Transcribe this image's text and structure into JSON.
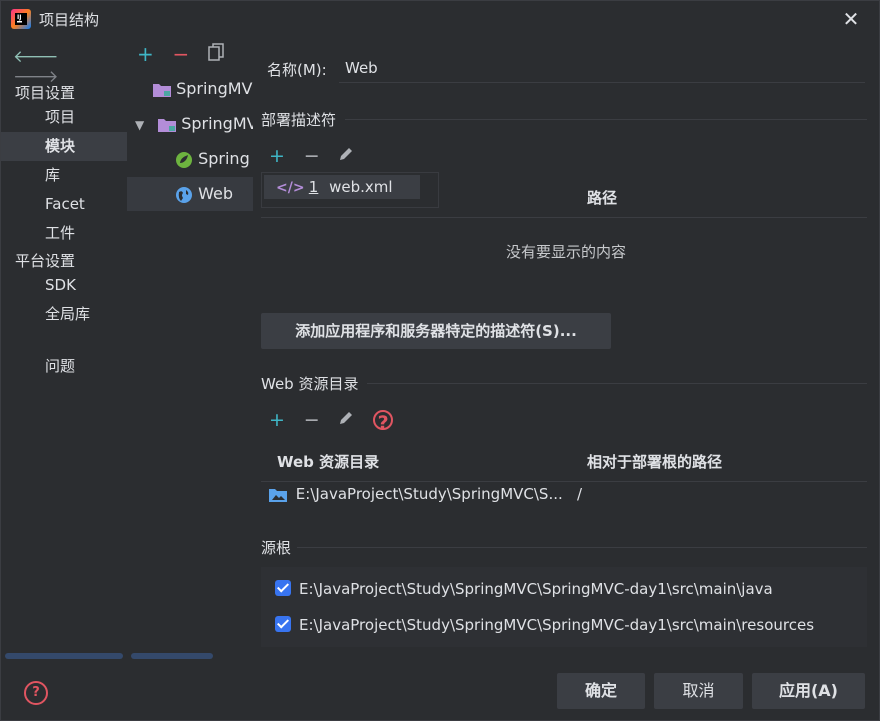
{
  "window": {
    "title": "项目结构",
    "close_glyph": "✕"
  },
  "sidebar": {
    "project_settings_header": "项目设置",
    "items_project": [
      "项目",
      "模块",
      "库",
      "Facet",
      "工件"
    ],
    "platform_settings_header": "平台设置",
    "items_platform": [
      "SDK",
      "全局库"
    ],
    "problems": "问题",
    "selected": "模块"
  },
  "tree": {
    "rows": [
      {
        "label": "SpringMVC",
        "icon": "module-folder-icon"
      },
      {
        "label": "SpringMVC",
        "icon": "module-folder-icon",
        "expanded": true
      },
      {
        "label": "Spring",
        "icon": "spring-icon"
      },
      {
        "label": "Web",
        "icon": "web-globe-icon",
        "selected": true
      }
    ]
  },
  "main": {
    "name_label": "名称(M):",
    "name_value": "Web",
    "deploy_section": "部署描述符",
    "popup_item_number": "1",
    "popup_item_label": "web.xml",
    "path_header": "路径",
    "empty_text": "没有要显示的内容",
    "add_descriptor_button": "添加应用程序和服务器特定的描述符(S)...",
    "web_resources_section": "Web 资源目录",
    "web_col_dir": "Web 资源目录",
    "web_col_relpath": "相对于部署根的路径",
    "web_row_dir": "E:\\JavaProject\\Study\\SpringMVC\\S...",
    "web_row_relpath": "/",
    "source_roots_section": "源根",
    "source_roots": [
      "E:\\JavaProject\\Study\\SpringMVC\\SpringMVC-day1\\src\\main\\java",
      "E:\\JavaProject\\Study\\SpringMVC\\SpringMVC-day1\\src\\main\\resources"
    ]
  },
  "footer": {
    "ok": "确定",
    "cancel": "取消",
    "apply": "应用(A)"
  },
  "colors": {
    "accent_blue": "#3874f0",
    "add_cyan": "#3fb6c6",
    "remove_red": "#e05561",
    "background": "#2b2d30"
  }
}
